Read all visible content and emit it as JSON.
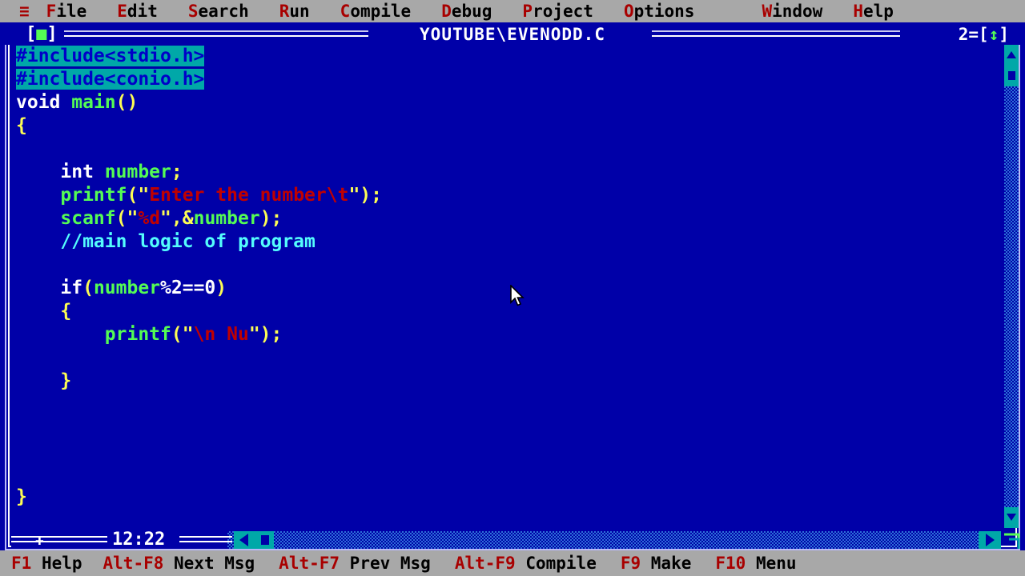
{
  "menubar": {
    "system_icon": "≡",
    "items": [
      {
        "hot": "F",
        "rest": "ile"
      },
      {
        "hot": "E",
        "rest": "dit"
      },
      {
        "hot": "S",
        "rest": "earch"
      },
      {
        "hot": "R",
        "rest": "un"
      },
      {
        "hot": "C",
        "rest": "ompile"
      },
      {
        "hot": "D",
        "rest": "ebug"
      },
      {
        "hot": "P",
        "rest": "roject"
      },
      {
        "hot": "O",
        "rest": "ptions"
      },
      {
        "hot": "W",
        "rest": "indow"
      },
      {
        "hot": "H",
        "rest": "elp"
      }
    ]
  },
  "window": {
    "title": "YOUTUBE\\EVENODD.C",
    "close_box_left": "[",
    "close_box_square": "■",
    "close_box_right": "]",
    "number": "2",
    "zoom_left": "=[",
    "zoom_icon": "↕",
    "zoom_right": "]",
    "cursor_position": "12:22"
  },
  "code": {
    "lines": [
      [
        {
          "t": "#include<stdio.h>",
          "c": "c-hl"
        }
      ],
      [
        {
          "t": "#include<conio.h>",
          "c": "c-hl"
        }
      ],
      [
        {
          "t": "void ",
          "c": "c-white"
        },
        {
          "t": "main",
          "c": "c-green"
        },
        {
          "t": "()",
          "c": "c-yellow"
        }
      ],
      [
        {
          "t": "{",
          "c": "c-yellow"
        }
      ],
      [
        {
          "t": "",
          "c": "c-white"
        }
      ],
      [
        {
          "t": "    int ",
          "c": "c-white"
        },
        {
          "t": "number",
          "c": "c-green"
        },
        {
          "t": ";",
          "c": "c-yellow"
        }
      ],
      [
        {
          "t": "    ",
          "c": "c-white"
        },
        {
          "t": "printf",
          "c": "c-green"
        },
        {
          "t": "(\"",
          "c": "c-yellow"
        },
        {
          "t": "Enter the number\\t",
          "c": "c-red"
        },
        {
          "t": "\");",
          "c": "c-yellow"
        }
      ],
      [
        {
          "t": "    ",
          "c": "c-white"
        },
        {
          "t": "scanf",
          "c": "c-green"
        },
        {
          "t": "(\"",
          "c": "c-yellow"
        },
        {
          "t": "%d",
          "c": "c-red"
        },
        {
          "t": "\",&",
          "c": "c-yellow"
        },
        {
          "t": "number",
          "c": "c-green"
        },
        {
          "t": ");",
          "c": "c-yellow"
        }
      ],
      [
        {
          "t": "    ",
          "c": "c-white"
        },
        {
          "t": "//main logic of program",
          "c": "c-comment"
        }
      ],
      [
        {
          "t": "",
          "c": "c-white"
        }
      ],
      [
        {
          "t": "    if",
          "c": "c-white"
        },
        {
          "t": "(",
          "c": "c-yellow"
        },
        {
          "t": "number",
          "c": "c-green"
        },
        {
          "t": "%2==0",
          "c": "c-white"
        },
        {
          "t": ")",
          "c": "c-yellow"
        }
      ],
      [
        {
          "t": "    {",
          "c": "c-yellow"
        }
      ],
      [
        {
          "t": "        ",
          "c": "c-white"
        },
        {
          "t": "printf",
          "c": "c-green"
        },
        {
          "t": "(\"",
          "c": "c-yellow"
        },
        {
          "t": "\\n Nu",
          "c": "c-red"
        },
        {
          "t": "\");",
          "c": "c-yellow"
        }
      ],
      [
        {
          "t": "",
          "c": "c-white"
        }
      ],
      [
        {
          "t": "    }",
          "c": "c-yellow"
        }
      ],
      [
        {
          "t": "",
          "c": "c-white"
        }
      ],
      [
        {
          "t": "",
          "c": "c-white"
        }
      ],
      [
        {
          "t": "",
          "c": "c-white"
        }
      ],
      [
        {
          "t": "",
          "c": "c-white"
        }
      ],
      [
        {
          "t": "}",
          "c": "c-yellow"
        }
      ]
    ]
  },
  "statusbar": {
    "items": [
      {
        "key": "F1",
        "label": "Help",
        "pad": 26
      },
      {
        "key": "Alt-F8",
        "label": "Next Msg",
        "pad": 30
      },
      {
        "key": "Alt-F7",
        "label": "Prev Msg",
        "pad": 30
      },
      {
        "key": "Alt-F9",
        "label": "Compile",
        "pad": 30
      },
      {
        "key": "F9",
        "label": "Make",
        "pad": 30
      },
      {
        "key": "F10",
        "label": "Menu",
        "pad": 0
      }
    ]
  },
  "colors": {
    "menu_bg": "#a8a8a8",
    "hotkey": "#a80000",
    "editor_bg": "#0000a8",
    "highlight_bg": "#00a8a8",
    "string": "#c00000",
    "identifier": "#54fc54",
    "punct": "#fcfc54",
    "comment": "#54fcfc"
  }
}
